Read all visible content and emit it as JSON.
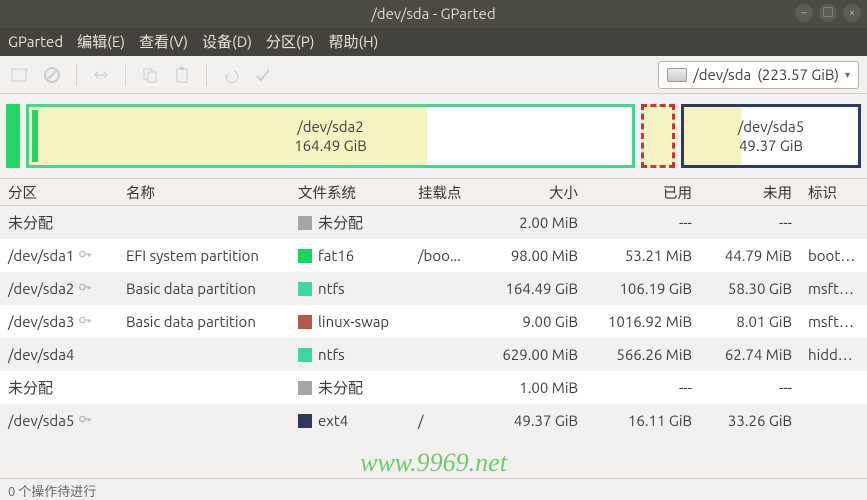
{
  "window": {
    "title": "/dev/sda - GParted"
  },
  "menu": {
    "app": "GParted",
    "edit": "编辑(E)",
    "view": "查看(V)",
    "device": "设备(D)",
    "partition": "分区(P)",
    "help": "帮助(H)"
  },
  "device_selector": {
    "device": "/dev/sda",
    "size": "(223.57 GiB)"
  },
  "graph": {
    "sda2_name": "/dev/sda2",
    "sda2_size": "164.49 GiB",
    "sda5_name": "/dev/sda5",
    "sda5_size": "49.37 GiB"
  },
  "headers": {
    "partition": "分区",
    "name": "名称",
    "fs": "文件系统",
    "mount": "挂载点",
    "size": "大小",
    "used": "已用",
    "unused": "未用",
    "flags": "标识"
  },
  "fs_colors": {
    "unallocated": "#a5a5a5",
    "fat16": "#18d860",
    "ntfs": "#3fd6a0",
    "linux_swap": "#b55a4a",
    "ext4": "#2f3a5f"
  },
  "rows": [
    {
      "partition": "未分配",
      "key": false,
      "name": "",
      "fs_label": "未分配",
      "fs_color": "unallocated",
      "mount": "",
      "size": "2.00 MiB",
      "used": "---",
      "unused": "---",
      "flags": ""
    },
    {
      "partition": "/dev/sda1",
      "key": true,
      "name": "EFI system partition",
      "fs_label": "fat16",
      "fs_color": "fat16",
      "mount": "/boo...",
      "size": "98.00 MiB",
      "used": "53.21 MiB",
      "unused": "44.79 MiB",
      "flags": "boot, esp"
    },
    {
      "partition": "/dev/sda2",
      "key": true,
      "name": "Basic data partition",
      "fs_label": "ntfs",
      "fs_color": "ntfs",
      "mount": "",
      "size": "164.49 GiB",
      "used": "106.19 GiB",
      "unused": "58.30 GiB",
      "flags": "msftdata"
    },
    {
      "partition": "/dev/sda3",
      "key": true,
      "name": "Basic data partition",
      "fs_label": "linux-swap",
      "fs_color": "linux_swap",
      "mount": "",
      "size": "9.00 GiB",
      "used": "1016.92 MiB",
      "unused": "8.01 GiB",
      "flags": "msftdata"
    },
    {
      "partition": "/dev/sda4",
      "key": false,
      "name": "",
      "fs_label": "ntfs",
      "fs_color": "ntfs",
      "mount": "",
      "size": "629.00 MiB",
      "used": "566.26 MiB",
      "unused": "62.74 MiB",
      "flags": "hidden, diag"
    },
    {
      "partition": "未分配",
      "key": false,
      "name": "",
      "fs_label": "未分配",
      "fs_color": "unallocated",
      "mount": "",
      "size": "1.00 MiB",
      "used": "---",
      "unused": "---",
      "flags": ""
    },
    {
      "partition": "/dev/sda5",
      "key": true,
      "name": "",
      "fs_label": "ext4",
      "fs_color": "ext4",
      "mount": "/",
      "size": "49.37 GiB",
      "used": "16.11 GiB",
      "unused": "33.26 GiB",
      "flags": ""
    }
  ],
  "watermark": "www.9969.net",
  "status": "0 个操作待进行"
}
